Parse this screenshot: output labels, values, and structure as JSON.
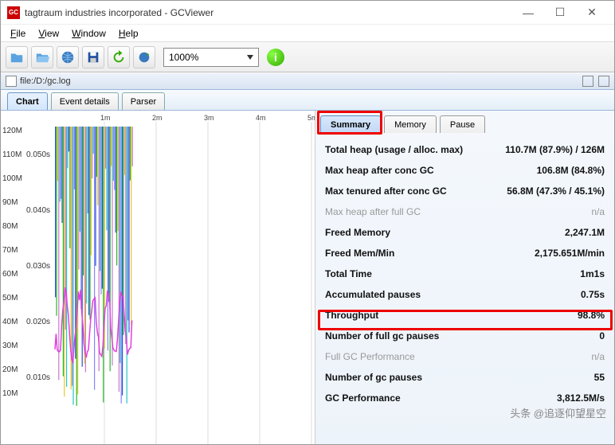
{
  "window": {
    "title": "tagtraum industries incorporated - GCViewer",
    "icon_text": "GC"
  },
  "menubar": {
    "file": "File",
    "view": "View",
    "window": "Window",
    "help": "Help"
  },
  "toolbar": {
    "zoom_value": "1000%"
  },
  "path": {
    "text": "file:/D:/gc.log"
  },
  "outer_tabs": {
    "chart": "Chart",
    "event_details": "Event details",
    "parser": "Parser"
  },
  "chart": {
    "x_ticks": [
      "1m",
      "2m",
      "3m",
      "4m",
      "5m"
    ],
    "y_mem": [
      "120M",
      "110M",
      "100M",
      "90M",
      "80M",
      "70M",
      "60M",
      "50M",
      "40M",
      "30M",
      "20M",
      "10M"
    ],
    "y_time": [
      "0.050s",
      "0.040s",
      "0.030s",
      "0.020s",
      "0.010s"
    ]
  },
  "sub_tabs": {
    "summary": "Summary",
    "memory": "Memory",
    "pause": "Pause"
  },
  "stats": [
    {
      "label": "Total heap (usage / alloc. max)",
      "value": "110.7M (87.9%) / 126M"
    },
    {
      "label": "Max heap after conc GC",
      "value": "106.8M (84.8%)"
    },
    {
      "label": "Max tenured after conc GC",
      "value": "56.8M (47.3% / 45.1%)"
    },
    {
      "label": "Max heap after full GC",
      "value": "n/a",
      "dim": true
    },
    {
      "label": "Freed Memory",
      "value": "2,247.1M"
    },
    {
      "label": "Freed Mem/Min",
      "value": "2,175.651M/min"
    },
    {
      "label": "Total Time",
      "value": "1m1s"
    },
    {
      "label": "Accumulated pauses",
      "value": "0.75s"
    },
    {
      "label": "Throughput",
      "value": "98.8%",
      "highlight": true
    },
    {
      "label": "Number of full gc pauses",
      "value": "0"
    },
    {
      "label": "Full GC Performance",
      "value": "n/a",
      "dim": true
    },
    {
      "label": "Number of gc pauses",
      "value": "55"
    },
    {
      "label": "GC Performance",
      "value": "3,812.5M/s",
      "cut": true
    }
  ],
  "watermark": "头条 @追逐仰望星空"
}
